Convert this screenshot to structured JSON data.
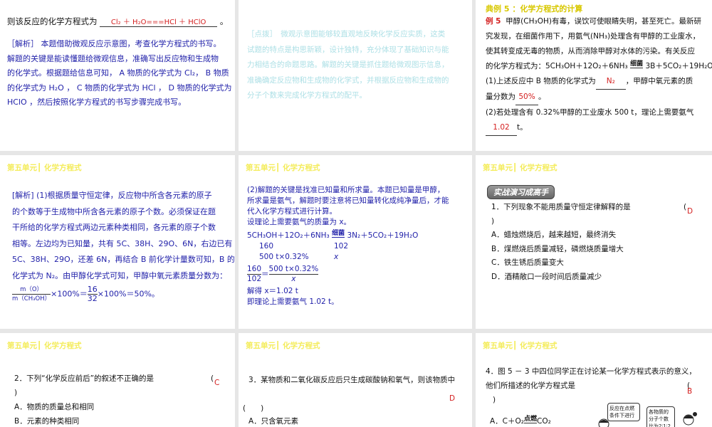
{
  "slides": [
    {
      "intro": "则该反应的化学方程式为",
      "answer": "Cl₂ ＋ H₂O===HCl ＋ HClO",
      "end": "。",
      "analysis": [
        "［解析］ 本题借助微观反应示意图，考查化学方程式的书写。",
        "解题的关键是能读懂题给微观信息，准确写出反应物和生成物",
        "的化学式。根据题给信息可知， A 物质的化学式为 Cl₂， B 物质",
        "的化学式为 H₂O ， C 物质的化学式为 HCl ， D 物质的化学式为",
        "HClO ，然后按照化学方程式的书写步骤完成书写。"
      ]
    },
    {
      "tip": [
        "［点拨］　微观示意图能够较直观地反映化学反应实质，这类",
        "试题的特点是构思新颖，设计独特，充分体现了基础知识与能",
        "力相结合的命题思路。解题的关键是抓住题给微观图示信息，",
        "准确确定反应物和生成物的化学式，并根据反应物和生成物的",
        "分子个数来完成化学方程式的配平。"
      ]
    },
    {
      "title": "典例 5 ：化学方程式的计算",
      "label": "例 5",
      "lines": [
        "甲醇(CH₃OH)有毒，误饮可使眼睛失明，甚至死亡。最新研",
        "究发现，在细菌作用下，用氨气(NH₃)处理含有甲醇的工业废水，",
        "使其转变成无毒的物质，从而消除甲醇对水体的污染。有关反应"
      ],
      "eq_prefix": "的化学方程式为：5CH₃OH＋12O₂＋6NH₃",
      "eq_cond": "细菌",
      "eq_suffix": "3B＋5CO₂＋19H₂O。",
      "q1a": "(1)上述反应中 B 物质的化学式为",
      "q1_ans": "N₂",
      "q1b": "，甲醇中氧元素的质",
      "q1c": "量分数为",
      "q1_ans2": "50%",
      "q1d": "。",
      "q2": "(2)若处理含有 0.32%甲醇的工业废水 500 t，理论上需要氨气",
      "q2_ans": "1.02",
      "q2_end": "t。"
    },
    {
      "header": "第五单元┃ 化学方程式",
      "lines": [
        "[解析] (1)根据质量守恒定律，反应物中所含各元素的原子",
        "的个数等于生成物中所含各元素的原子个数。必须保证在题",
        "干所给的化学方程式两边元素种类相同，各元素的原子个数",
        "相等。左边均为已知量，共有 5C、38H、29O、6N，右边已有",
        "5C、38H、29O，还差 6N，再结合 B 前化学计量数可知，B 的",
        "化学式为 N₂。由甲醇化学式可知，甲醇中氧元素质量分数为："
      ],
      "frac_num": "m（O）",
      "frac_den": "m（CH₃OH）",
      "mid": "×100%＝",
      "f2_num": "16",
      "f2_den": "32",
      "tail": "×100%＝50%。"
    },
    {
      "header": "第五单元┃ 化学方程式",
      "lines": [
        "(2)解题的关键是找准已知量和所求量。本题已知量是甲醇，",
        "所求量是氨气，解题时要注意将已知量转化成纯净量后，才能",
        "代入化学方程式进行计算。",
        "设理论上需要氨气的质量为 x。"
      ],
      "eq_left": "5CH₃OH＋12O₂＋6NH₃",
      "eq_cond": "细菌",
      "eq_right": "3N₂＋5CO₂＋19H₂O",
      "r1a": "160",
      "r1b": "102",
      "r2a": "500 t×0.32%",
      "r2b": "x",
      "p_num": "160",
      "p_den": "102",
      "eqs": "＝",
      "p2_num": "500 t×0.32%",
      "p2_den": "x",
      "sol": "解得 x＝1.02 t",
      "concl": "即理论上需要氨气 1.02 t。"
    },
    {
      "header": "第五单元┃ 化学方程式",
      "badge": "实战演习成高手",
      "q": "1．下列现象不能用质量守恒定律解释的是",
      "paren": "(",
      "close": ")",
      "ans": "D",
      "opts": [
        "A．蜡烛燃烧后，越来越短，最终消失",
        "B．煤燃烧后质量减轻，磷燃烧质量增大",
        "C．铁生锈后质量变大",
        "D．酒精敞口一段时间后质量减少"
      ]
    },
    {
      "header": "第五单元┃ 化学方程式",
      "q": "2．下列“化学反应前后”的叙述不正确的是",
      "paren": "(",
      "close": ")",
      "ans": "C",
      "opts": [
        "A．物质的质量总和相同",
        "B．元素的种类相同"
      ]
    },
    {
      "header": "第五单元┃ 化学方程式",
      "q": "3．某物质和二氧化碳反应后只生成碳酸钠和氧气，则该物质中",
      "blank": "(　　)",
      "ans": "D",
      "opts": [
        "A．只含氧元素"
      ]
    },
    {
      "header": "第五单元┃ 化学方程式",
      "q1": "4．图 5 － 3 中四位同学正在讨论某一化学方程式表示的意义，",
      "q2": "他们所描述的化学方程式是",
      "paren": "(",
      "close": ")",
      "ans": "B",
      "optA_left": "A．C＋O₂",
      "optA_cond": "点燃",
      "optA_right": "CO₂",
      "bubble1": "反应在点燃条件下进行",
      "bubble2": "各物质的分子个数比为2∶1∶2"
    }
  ]
}
